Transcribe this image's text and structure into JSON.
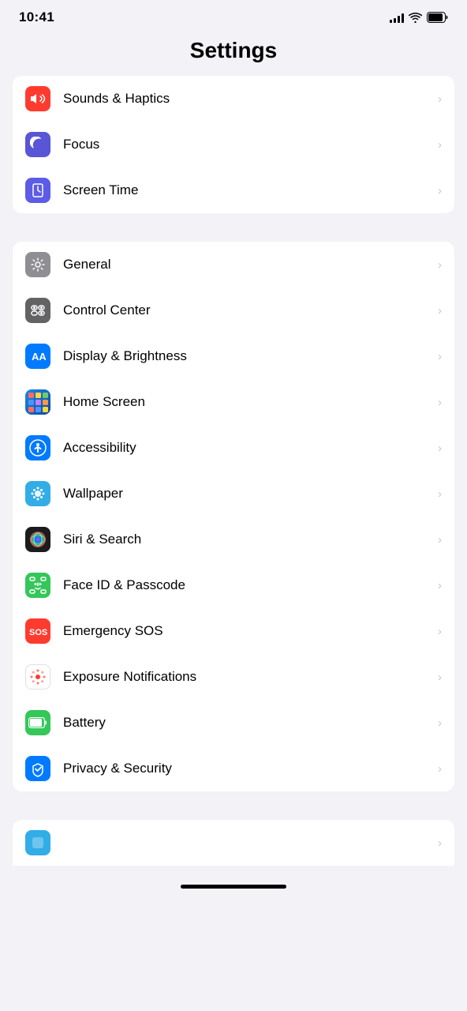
{
  "statusBar": {
    "time": "10:41"
  },
  "header": {
    "title": "Settings"
  },
  "sections": [
    {
      "id": "section1",
      "items": [
        {
          "id": "sounds-haptics",
          "label": "Sounds & Haptics",
          "iconBg": "icon-red",
          "iconType": "speaker"
        },
        {
          "id": "focus",
          "label": "Focus",
          "iconBg": "icon-purple-dark",
          "iconType": "moon"
        },
        {
          "id": "screen-time",
          "label": "Screen Time",
          "iconBg": "icon-purple-mid",
          "iconType": "hourglass"
        }
      ]
    },
    {
      "id": "section2",
      "items": [
        {
          "id": "general",
          "label": "General",
          "iconBg": "icon-gray",
          "iconType": "gear"
        },
        {
          "id": "control-center",
          "label": "Control Center",
          "iconBg": "icon-gray2",
          "iconType": "toggle"
        },
        {
          "id": "display-brightness",
          "label": "Display & Brightness",
          "iconBg": "icon-blue",
          "iconType": "aa"
        },
        {
          "id": "home-screen",
          "label": "Home Screen",
          "iconBg": "icon-blue",
          "iconType": "grid"
        },
        {
          "id": "accessibility",
          "label": "Accessibility",
          "iconBg": "icon-blue",
          "iconType": "person-circle"
        },
        {
          "id": "wallpaper",
          "label": "Wallpaper",
          "iconBg": "icon-teal",
          "iconType": "flower"
        },
        {
          "id": "siri-search",
          "label": "Siri & Search",
          "iconBg": "icon-black",
          "iconType": "siri"
        },
        {
          "id": "face-id",
          "label": "Face ID & Passcode",
          "iconBg": "icon-green",
          "iconType": "face"
        },
        {
          "id": "emergency-sos",
          "label": "Emergency SOS",
          "iconBg": "icon-red-sos",
          "iconType": "sos"
        },
        {
          "id": "exposure",
          "label": "Exposure Notifications",
          "iconBg": "icon-white",
          "iconType": "dots"
        },
        {
          "id": "battery",
          "label": "Battery",
          "iconBg": "icon-green-batt",
          "iconType": "battery"
        },
        {
          "id": "privacy-security",
          "label": "Privacy & Security",
          "iconBg": "icon-blue-hand",
          "iconType": "hand"
        }
      ]
    }
  ],
  "bottomPeek": {
    "iconBg": "icon-teal",
    "iconType": "generic"
  }
}
